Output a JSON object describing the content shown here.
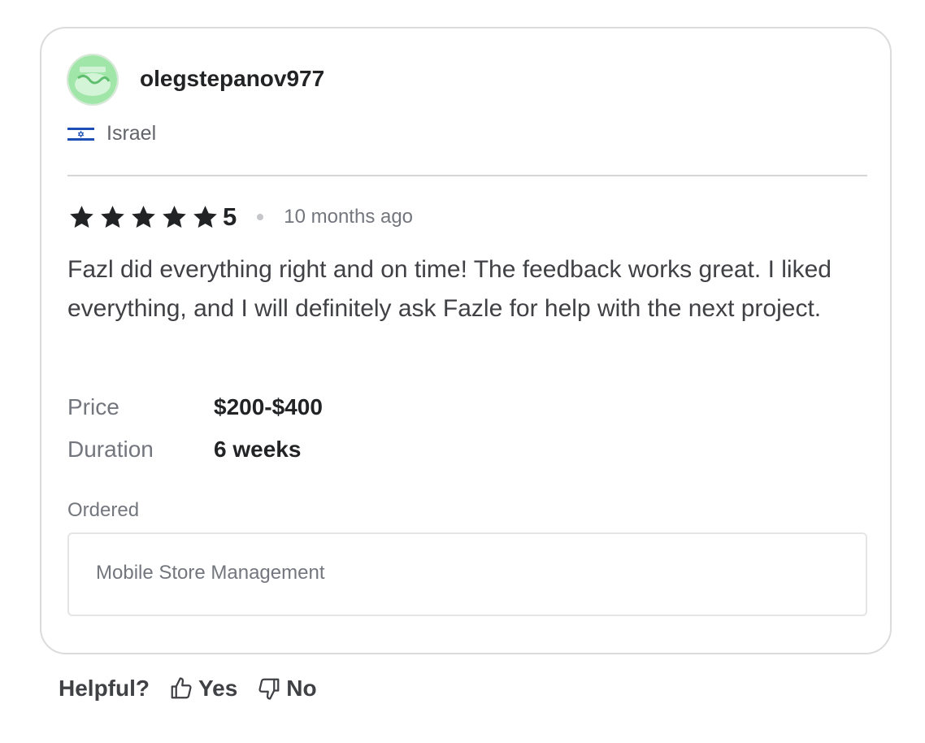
{
  "review": {
    "username": "olegstepanov977",
    "avatar_icon": "avatar-image",
    "country": "Israel",
    "flag_icon": "israel-flag-icon",
    "rating": "5",
    "time_ago": "10 months ago",
    "text": "Fazl did everything right and on time! The feedback works great. I liked everything, and I will definitely ask Fazle for help with the next project.",
    "details": [
      {
        "label": "Price",
        "value": "$200-$400"
      },
      {
        "label": "Duration",
        "value": "6 weeks"
      }
    ],
    "ordered_label": "Ordered",
    "ordered_item": "Mobile Store Management"
  },
  "feedback": {
    "helpful_label": "Helpful?",
    "yes_label": "Yes",
    "no_label": "No"
  },
  "colors": {
    "star": "#222325",
    "border": "#dadbdd",
    "muted_text": "#74767e"
  }
}
